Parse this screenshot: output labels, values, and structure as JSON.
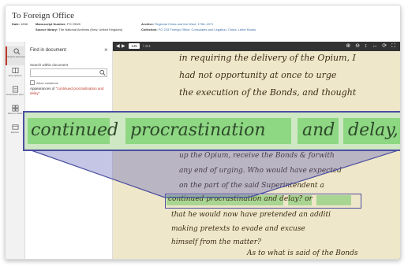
{
  "header": {
    "title": "To Foreign Office",
    "date_label": "Date:",
    "date_value": "1836",
    "manuscript_label": "Manuscript Number:",
    "manuscript_value": "FO 233/8",
    "archive_label": "Archive:",
    "archive_value": "Regional China and the West, 1756–1971",
    "source_label": "Source library:",
    "source_value": "The National Archives (Kew, United Kingdom)",
    "collection_label": "Collection:",
    "collection_value": "FO 233 Foreign Office: Consulates and Legation, China: Letter Books"
  },
  "sidebar": {
    "items": [
      {
        "label": "Search document",
        "icon": "search-icon"
      },
      {
        "label": "View options",
        "icon": "book-icon"
      },
      {
        "label": "Download / print",
        "icon": "download-icon"
      },
      {
        "label": "Save to folder",
        "icon": "folder-icon"
      },
      {
        "label": "Explore",
        "icon": "explore-icon"
      }
    ]
  },
  "find_panel": {
    "title": "Find in document",
    "close": "×",
    "search_label": "Search within document",
    "search_value": "",
    "allow_variations": "Allow variations",
    "results_prefix": "Appearances of",
    "query": "\"continued procrastination and delay\""
  },
  "toolbar": {
    "page_value": "145",
    "page_total": "/ 341",
    "tools": "⊕ ⊖ ↕ ↔ ⟳ ⛶"
  },
  "manuscript": {
    "lines": [
      "in requiring the delivery of the Opium, I",
      "had not opportunity at once to urge",
      "the execution of the Bonds, and thought",
      "up the Opium, receive the Bonds & forwith",
      "any end of urging. Who would have expected",
      "on the part of the said Superintendent a",
      "continued procrastination and delay? or",
      "that he would now have pretended an additi",
      "making pretexts to evade and excuse",
      "himself from the matter?",
      "As to what is said of the Bonds"
    ],
    "zoom_words": [
      "continued",
      "procrastination",
      "and",
      "delay,"
    ]
  },
  "colors": {
    "highlight": "#6ec864",
    "zoom_border": "#4a4fa0",
    "accent_red": "#c0392b",
    "paper": "#efe7c9"
  }
}
